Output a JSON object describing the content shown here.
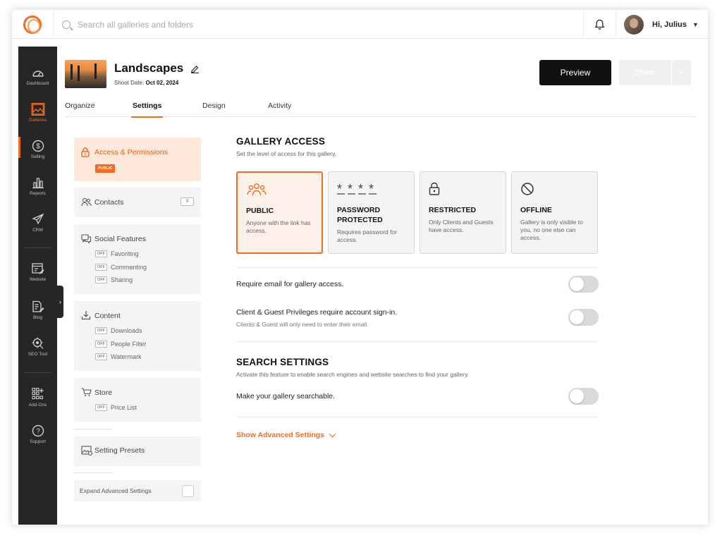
{
  "topbar": {
    "search_placeholder": "Search all galleries and folders",
    "user_greeting": "Hi, Julius"
  },
  "rail": {
    "items": [
      {
        "label": "Dashboard",
        "icon": "gauge-icon"
      },
      {
        "label": "Galleries",
        "icon": "gallery-icon",
        "active": true
      },
      {
        "label": "Selling",
        "icon": "dollar-icon"
      },
      {
        "label": "Reports",
        "icon": "bar-chart-icon"
      },
      {
        "label": "CRM",
        "icon": "send-icon"
      },
      {
        "label": "Website",
        "icon": "website-icon"
      },
      {
        "label": "Blog",
        "icon": "blog-icon"
      },
      {
        "label": "SEO Tool",
        "icon": "seo-icon"
      },
      {
        "label": "Add-Ons",
        "icon": "addons-icon"
      },
      {
        "label": "Support",
        "icon": "help-icon"
      }
    ]
  },
  "header": {
    "title": "Landscapes",
    "shoot_date_label": "Shoot Date:",
    "shoot_date": "Oct 02, 2024",
    "preview_label": "Preview",
    "share_label": "Share"
  },
  "tabs": [
    "Organize",
    "Settings",
    "Design",
    "Activity"
  ],
  "sidebar": {
    "access": {
      "title": "Access & Permissions",
      "badge": "PUBLIC"
    },
    "contacts": {
      "title": "Contacts",
      "count": "0"
    },
    "social": {
      "title": "Social Features",
      "items": [
        {
          "badge": "OFF",
          "label": "Favoriting"
        },
        {
          "badge": "OFF",
          "label": "Commenting"
        },
        {
          "badge": "OFF",
          "label": "Sharing"
        }
      ]
    },
    "content": {
      "title": "Content",
      "items": [
        {
          "badge": "OFF",
          "label": "Downloads"
        },
        {
          "badge": "OFF",
          "label": "People Filter"
        },
        {
          "badge": "OFF",
          "label": "Watermark"
        }
      ]
    },
    "store": {
      "title": "Store",
      "items": [
        {
          "badge": "OFF",
          "label": "Price List"
        }
      ]
    },
    "presets": {
      "title": "Setting Presets"
    },
    "expand": {
      "label": "Expand Advanced Settings"
    }
  },
  "gallery_access": {
    "title": "GALLERY ACCESS",
    "description": "Set the level of access for this gallery.",
    "cards": [
      {
        "title": "PUBLIC",
        "desc": "Anyone with the link has access.",
        "selected": true
      },
      {
        "title": "PASSWORD PROTECTED",
        "desc": "Requires password for access."
      },
      {
        "title": "RESTRICTED",
        "desc": "Only Clients and Guests have access."
      },
      {
        "title": "OFFLINE",
        "desc": "Gallery is only visible to you, no one else can access."
      }
    ],
    "require_email": "Require email for gallery access.",
    "privileges_label": "Client & Guest Privileges require account sign-in.",
    "privileges_sub": "Clients & Guest will only need to enter their email."
  },
  "search_settings": {
    "title": "SEARCH SETTINGS",
    "description": "Activate this feature to enable search engines and website searches to find your gallery.",
    "searchable_label": "Make your gallery searchable.",
    "advanced_link": "Show Advanced Settings"
  },
  "colors": {
    "accent": "#f26b21",
    "rail_bg": "#262626"
  }
}
